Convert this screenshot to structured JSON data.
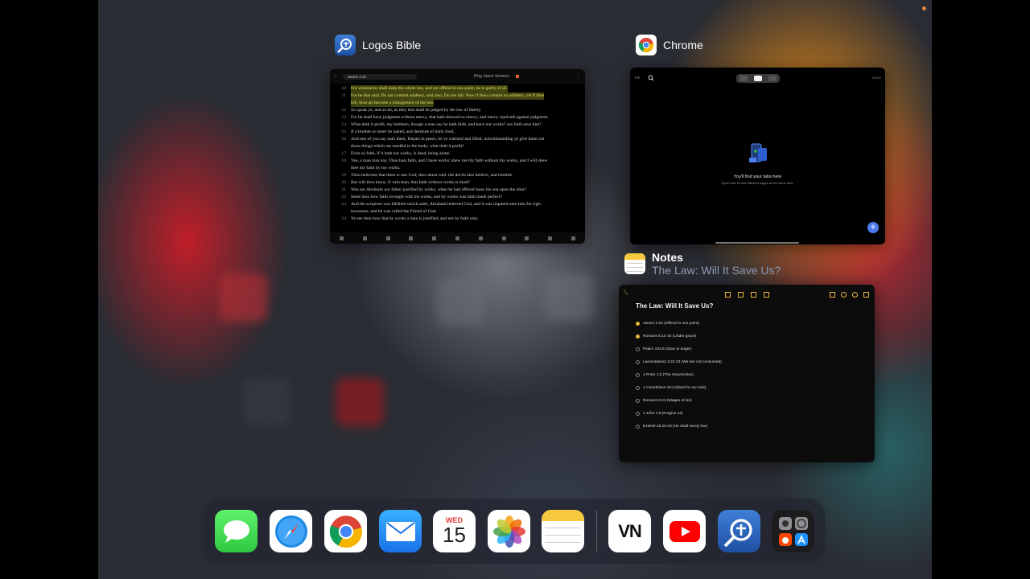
{
  "cards": {
    "logos": {
      "title": "Logos Bible",
      "search": "James 2:10",
      "header_right": "Ping Jason Session",
      "verses": [
        {
          "num": "10",
          "text": "For whosoever shall keep the whole law, and yet offend in one point, he is guilty of all.",
          "highlight": true
        },
        {
          "num": "11",
          "text": "For he that said, Do not commit adultery, said also, Do not kill. Now if thou commit no adultery, yet if thou",
          "highlight": true
        },
        {
          "num": "",
          "text": "kill, thou art become a transgressor of the law.",
          "highlight": true
        },
        {
          "num": "12",
          "text": "So speak ye, and so do, as they that shall be judged by the law of liberty.",
          "highlight": false
        },
        {
          "num": "13",
          "text": "For he shall have judgment without mercy, that hath shewed no mercy; and mercy rejoiceth against judgment.",
          "highlight": false
        },
        {
          "num": "14",
          "text": "What doth it profit, my brethren, though a man say he hath faith, and have not works? can faith save him?",
          "highlight": false
        },
        {
          "num": "15",
          "text": "If a brother or sister be naked, and destitute of daily food,",
          "highlight": false
        },
        {
          "num": "16",
          "text": "And one of you say unto them, Depart in peace, be ye warmed and filled; notwithstanding ye give them not",
          "highlight": false
        },
        {
          "num": "",
          "text": "those things which are needful to the body; what doth it profit?",
          "highlight": false
        },
        {
          "num": "17",
          "text": "Even so faith, if it hath not works, is dead, being alone.",
          "highlight": false
        },
        {
          "num": "18",
          "text": "Yea, a man may say, Thou hast faith, and I have works: shew me thy faith without thy works, and I will shew",
          "highlight": false
        },
        {
          "num": "",
          "text": "thee my faith by my works.",
          "highlight": false
        },
        {
          "num": "19",
          "text": "Thou believest that there is one God; thou doest well: the devils also believe, and tremble.",
          "highlight": false
        },
        {
          "num": "20",
          "text": "But wilt thou know, O vain man, that faith without works is dead?",
          "highlight": false
        },
        {
          "num": "21",
          "text": "Was not Abraham our father justified by works, when he had offered Isaac his son upon the altar?",
          "highlight": false
        },
        {
          "num": "22",
          "text": "Seest thou how faith wrought with his works, and by works was faith made perfect?",
          "highlight": false
        },
        {
          "num": "23",
          "text": "And the scripture was fulfilled which saith, Abraham believed God, and it was imputed unto him for righ-",
          "highlight": false
        },
        {
          "num": "",
          "text": "teousness: and he was called the Friend of God.",
          "highlight": false
        },
        {
          "num": "24",
          "text": "Ye see then how that by works a man is justified, and not by faith only.",
          "highlight": false
        }
      ]
    },
    "chrome": {
      "title": "Chrome",
      "left_label": "Tab",
      "right_label": "Done",
      "empty_title": "You'll find your tabs here",
      "empty_sub": "Open tabs to visit different pages at the same time."
    },
    "notes": {
      "title": "Notes",
      "subtitle": "The Law: Will It Save Us?",
      "note_title": "The Law: Will It Save Us?",
      "items": [
        {
          "text": "James 2:10 (Offend in one point)",
          "done": true
        },
        {
          "text": "Romans 6:14-15 (Under grace)",
          "done": true
        },
        {
          "text": "Psalm 103:8 (Slow to anger)",
          "done": false
        },
        {
          "text": "Lamentations 3:22-23 (We are not consumed)",
          "done": false
        },
        {
          "text": "1 Peter 1:3 (The resurrection)",
          "done": false
        },
        {
          "text": "1 Corinthians 15:3 (Died for our sins)",
          "done": false
        },
        {
          "text": "Romans 6:23 (Wages of sin)",
          "done": false
        },
        {
          "text": "1 John 1:9 (Forgive us)",
          "done": false
        },
        {
          "text": "Ezekiel 18:20-23 (He shall surely live)",
          "done": false
        }
      ]
    }
  },
  "dock": {
    "calendar_day": "WED",
    "calendar_date": "15",
    "vn_label": "VN"
  }
}
